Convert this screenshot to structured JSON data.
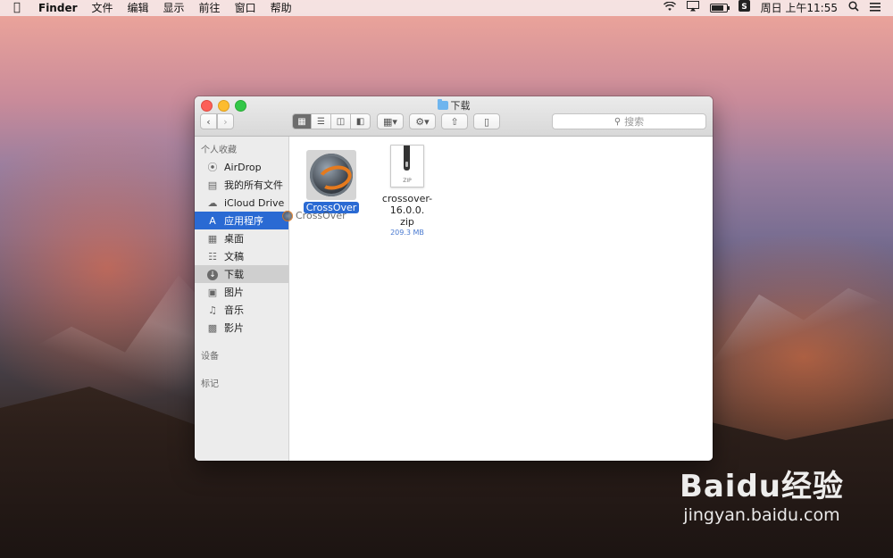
{
  "menubar": {
    "app_name": "Finder",
    "items": [
      "文件",
      "编辑",
      "显示",
      "前往",
      "窗口",
      "帮助"
    ],
    "clock": "周日 上午11:55",
    "battery_level": 0.7
  },
  "window": {
    "title": "下载",
    "search_placeholder": "搜索"
  },
  "sidebar": {
    "favorites_header": "个人收藏",
    "devices_header": "设备",
    "tags_header": "标记",
    "items": [
      {
        "label": "AirDrop",
        "icon": "airdrop-icon"
      },
      {
        "label": "我的所有文件",
        "icon": "all-files-icon"
      },
      {
        "label": "iCloud Drive",
        "icon": "cloud-icon"
      },
      {
        "label": "应用程序",
        "icon": "applications-icon"
      },
      {
        "label": "桌面",
        "icon": "desktop-icon"
      },
      {
        "label": "文稿",
        "icon": "documents-icon"
      },
      {
        "label": "下载",
        "icon": "downloads-icon"
      },
      {
        "label": "图片",
        "icon": "pictures-icon"
      },
      {
        "label": "音乐",
        "icon": "music-icon"
      },
      {
        "label": "影片",
        "icon": "movies-icon"
      }
    ]
  },
  "files": [
    {
      "name": "CrossOver",
      "selected": true
    },
    {
      "name": "crossover-16.0.0.zip",
      "name_line1": "crossover-16.0.0.",
      "name_line2": "zip",
      "size": "209.3 MB",
      "badge": "ZIP"
    }
  ],
  "drag_ghost": {
    "label": "CrossOver"
  },
  "watermark": {
    "brand": "Baidu经验",
    "url": "jingyan.baidu.com"
  }
}
